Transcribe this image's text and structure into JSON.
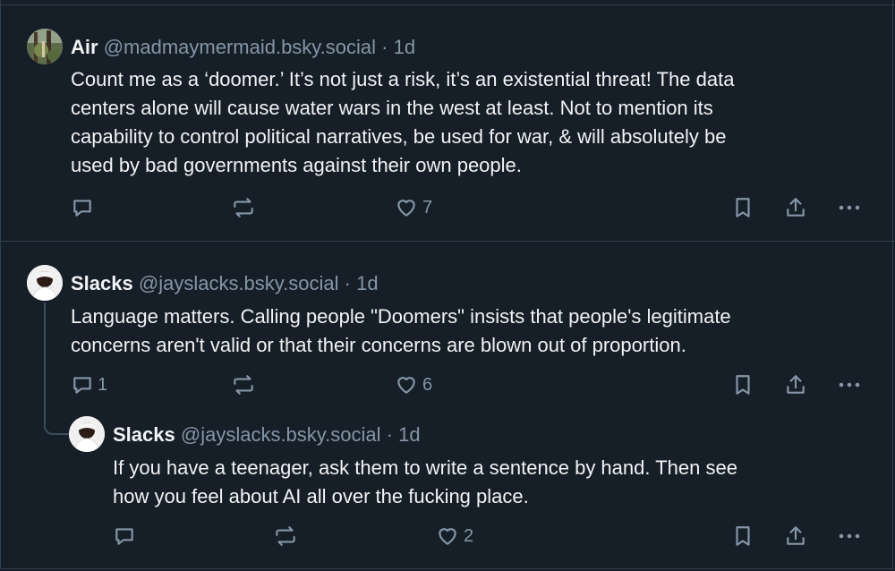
{
  "posts": [
    {
      "display_name": "Air",
      "handle": "@madmaymermaid.bsky.social",
      "separator": "·",
      "time": "1d",
      "lines": [
        "Count me as a ‘doomer.’ It’s not just a risk, it’s an existential threat! The data",
        "centers alone will cause water wars in the west at least. Not to mention its",
        "capability to control political narratives, be used for war, & will absolutely be",
        "used by bad governments against their own people."
      ],
      "reply_count": "",
      "repost_count": "",
      "like_count": "7",
      "avatar_icon": "forest-photo-avatar"
    },
    {
      "display_name": "Slacks",
      "handle": "@jayslacks.bsky.social",
      "separator": "·",
      "time": "1d",
      "lines": [
        "Language matters. Calling people \"Doomers\" insists that people's legitimate",
        "concerns aren't valid or that their concerns are blown out of proportion."
      ],
      "reply_count": "1",
      "repost_count": "",
      "like_count": "6",
      "avatar_icon": "person-photo-avatar"
    },
    {
      "display_name": "Slacks",
      "handle": "@jayslacks.bsky.social",
      "separator": "·",
      "time": "1d",
      "lines": [
        "If you have a teenager, ask them to write a sentence by hand. Then see",
        "how you feel about AI all over the fucking place."
      ],
      "reply_count": "",
      "repost_count": "",
      "like_count": "2",
      "avatar_icon": "person-photo-avatar"
    }
  ],
  "icons": {
    "reply": "speech-bubble-icon",
    "repost": "repost-arrows-icon",
    "like": "heart-icon",
    "bookmark": "bookmark-icon",
    "share": "share-icon",
    "more": "ellipsis-icon"
  },
  "colors": {
    "background": "#161e27",
    "border": "#2e4052",
    "text": "#f1f3f5",
    "muted": "#8596a8"
  }
}
